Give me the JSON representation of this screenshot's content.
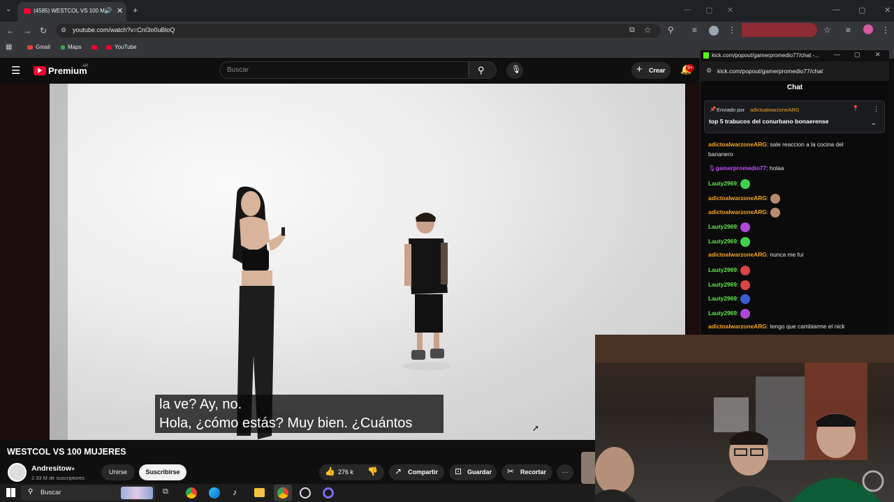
{
  "browser": {
    "tab_title": "(4585) WESTCOL VS 100 M",
    "url": "youtube.com/watch?v=CnI3o0uBloQ",
    "bookmarks": [
      "Gmail",
      "Maps",
      "YouTube"
    ]
  },
  "youtube": {
    "logo_text": "Premium",
    "logo_region": "AR",
    "search_placeholder": "Buscar",
    "create_label": "Crear",
    "notif_badge": "9+",
    "subtitle_line1": "la ve? Ay, no.",
    "subtitle_line2": "Hola, ¿cómo estás? Muy bien. ¿Cuántos",
    "video_title": "WESTCOL VS 100 MUJERES",
    "channel_name": "Andresitow",
    "subscribers": "2.33 M de suscriptores",
    "join_label": "Unirse",
    "subscribe_label": "Suscribirse",
    "likes": "276 k",
    "share_label": "Compartir",
    "save_label": "Guardar",
    "clip_label": "Recortar"
  },
  "kick": {
    "window_title": "kick.com/popout/gamerpromedio77/chat -...",
    "url": "kick.com/popout/gamerpromedio77/chat",
    "header": "Chat",
    "pinned_prefix": "Enviado por",
    "pinned_user": "adictoalwarzoneARG",
    "pinned_text": "top 5 trabucos del conurbano bonaerense",
    "messages": [
      {
        "user": "adictoalwarzoneARG",
        "text": "sale reaccion a la cocina del",
        "text2": "bananero",
        "color": "#f5a623"
      },
      {
        "user": "gamerpromedio77",
        "text": "holaa",
        "color": "#c24bff"
      },
      {
        "user": "Lauty2969",
        "text": "",
        "color": "#63e64d",
        "emote": "#3fd14a"
      },
      {
        "user": "adictoalwarzoneARG",
        "text": "",
        "color": "#f5a623",
        "emote": "#b98a70"
      },
      {
        "user": "adictoalwarzoneARG",
        "text": "",
        "color": "#f5a623",
        "emote": "#b98a70"
      },
      {
        "user": "Lauty2969",
        "text": "",
        "color": "#63e64d",
        "emote": "#b04ad6"
      },
      {
        "user": "Lauty2969",
        "text": "",
        "color": "#63e64d",
        "emote": "#3fd14a"
      },
      {
        "user": "adictoalwarzoneARG",
        "text": "nunca me fui",
        "color": "#f5a623"
      },
      {
        "user": "Lauty2969",
        "text": "",
        "color": "#63e64d",
        "emote": "#d94545"
      },
      {
        "user": "Lauty2969",
        "text": "",
        "color": "#63e64d",
        "emote": "#d94545"
      },
      {
        "user": "Lauty2969",
        "text": "",
        "color": "#63e64d",
        "emote": "#3b5ed6"
      },
      {
        "user": "Lauty2969",
        "text": "",
        "color": "#63e64d",
        "emote": "#b04ad6"
      },
      {
        "user": "adictoalwarzoneARG",
        "text": "tengo que cambiarme el nick",
        "color": "#f5a623"
      }
    ]
  },
  "taskbar": {
    "search_label": "Buscar"
  }
}
